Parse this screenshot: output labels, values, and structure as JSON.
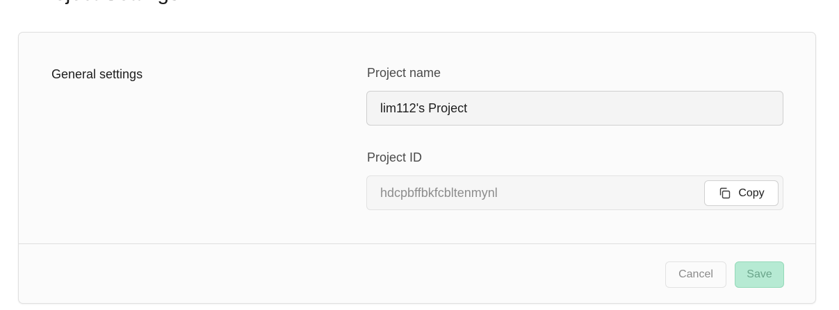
{
  "page": {
    "title": "Project Settings"
  },
  "general": {
    "section_title": "General settings",
    "project_name_label": "Project name",
    "project_name_value": "lim112's Project",
    "project_id_label": "Project ID",
    "project_id_value": "hdcpbffbkfcbltenmynl",
    "copy_label": "Copy",
    "copy_icon": "copy-icon"
  },
  "footer": {
    "cancel_label": "Cancel",
    "save_label": "Save"
  },
  "colors": {
    "save_bg": "#b6ead3",
    "save_border": "#93d9b8",
    "save_text": "#6aa48a"
  }
}
